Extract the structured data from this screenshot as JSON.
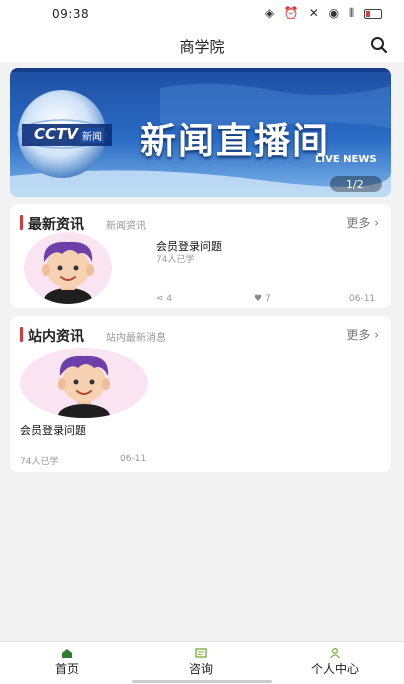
{
  "status": {
    "time": "09:38"
  },
  "header": {
    "title": "商学院"
  },
  "banner": {
    "logo_text": "CCTV",
    "logo_sub": "新闻",
    "headline": "新闻直播间",
    "subline": "LIVE NEWS",
    "page_indicator": "1/2"
  },
  "latest": {
    "title": "最新资讯",
    "subtitle": "新闻资讯",
    "more": "更多",
    "item": {
      "title": "会员登录问题",
      "learners": "74人已学",
      "shares": "4",
      "likes": "7",
      "date": "06-11"
    }
  },
  "site": {
    "title": "站内资讯",
    "subtitle": "站内最新消息",
    "more": "更多",
    "item": {
      "title": "会员登录问题",
      "learners": "74人已学",
      "date": "06-11"
    }
  },
  "tabs": [
    {
      "label": "首页",
      "icon": "home-icon",
      "color": "#2e7d32"
    },
    {
      "label": "咨询",
      "icon": "chat-icon",
      "color": "#7cb342"
    },
    {
      "label": "个人中心",
      "icon": "user-icon",
      "color": "#7cb342"
    }
  ]
}
